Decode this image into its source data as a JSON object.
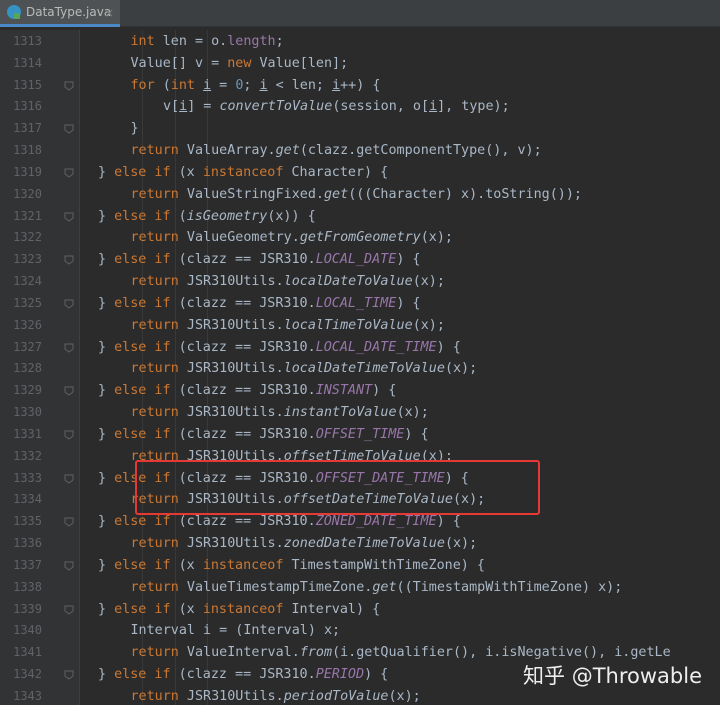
{
  "tab": {
    "label": "DataType.java",
    "close": "×"
  },
  "lines": [
    {
      "n": "1313",
      "fold": false,
      "indent": 3,
      "tokens": [
        [
          "kw",
          "int"
        ],
        [
          "t",
          " len = o."
        ],
        [
          "cst2",
          "length"
        ],
        [
          "t",
          ";"
        ]
      ]
    },
    {
      "n": "1314",
      "fold": false,
      "indent": 3,
      "tokens": [
        [
          "t",
          "Value[] v = "
        ],
        [
          "kw",
          "new"
        ],
        [
          "t",
          " Value[len];"
        ]
      ]
    },
    {
      "n": "1315",
      "fold": true,
      "indent": 3,
      "tokens": [
        [
          "kw",
          "for"
        ],
        [
          "t",
          " ("
        ],
        [
          "kw",
          "int"
        ],
        [
          "t",
          " "
        ],
        [
          "ul",
          "i"
        ],
        [
          "t",
          " = "
        ],
        [
          "num",
          "0"
        ],
        [
          "t",
          "; "
        ],
        [
          "ul",
          "i"
        ],
        [
          "t",
          " < len; "
        ],
        [
          "ul",
          "i"
        ],
        [
          "t",
          "++) {"
        ]
      ]
    },
    {
      "n": "1316",
      "fold": false,
      "indent": 4,
      "tokens": [
        [
          "t",
          "v["
        ],
        [
          "ul",
          "i"
        ],
        [
          "t",
          "] = "
        ],
        [
          "fn",
          "convertToValue"
        ],
        [
          "t",
          "(session, o["
        ],
        [
          "ul",
          "i"
        ],
        [
          "t",
          "], type);"
        ]
      ]
    },
    {
      "n": "1317",
      "fold": true,
      "indent": 3,
      "tokens": [
        [
          "t",
          "}"
        ]
      ]
    },
    {
      "n": "1318",
      "fold": false,
      "indent": 3,
      "tokens": [
        [
          "kw",
          "return"
        ],
        [
          "t",
          " ValueArray."
        ],
        [
          "fn",
          "get"
        ],
        [
          "t",
          "(clazz.getComponentType(), v);"
        ]
      ]
    },
    {
      "n": "1319",
      "fold": true,
      "indent": 2,
      "tokens": [
        [
          "t",
          "} "
        ],
        [
          "kw",
          "else if"
        ],
        [
          "t",
          " (x "
        ],
        [
          "kw",
          "instanceof"
        ],
        [
          "t",
          " Character) {"
        ]
      ]
    },
    {
      "n": "1320",
      "fold": false,
      "indent": 3,
      "tokens": [
        [
          "kw",
          "return"
        ],
        [
          "t",
          " ValueStringFixed."
        ],
        [
          "fn",
          "get"
        ],
        [
          "t",
          "(((Character) x).toString());"
        ]
      ]
    },
    {
      "n": "1321",
      "fold": true,
      "indent": 2,
      "tokens": [
        [
          "t",
          "} "
        ],
        [
          "kw",
          "else if"
        ],
        [
          "t",
          " ("
        ],
        [
          "fn",
          "isGeometry"
        ],
        [
          "t",
          "(x)) {"
        ]
      ]
    },
    {
      "n": "1322",
      "fold": false,
      "indent": 3,
      "tokens": [
        [
          "kw",
          "return"
        ],
        [
          "t",
          " ValueGeometry."
        ],
        [
          "fn",
          "getFromGeometry"
        ],
        [
          "t",
          "(x);"
        ]
      ]
    },
    {
      "n": "1323",
      "fold": true,
      "indent": 2,
      "tokens": [
        [
          "t",
          "} "
        ],
        [
          "kw",
          "else if"
        ],
        [
          "t",
          " (clazz == JSR310."
        ],
        [
          "cst",
          "LOCAL_DATE"
        ],
        [
          "t",
          ") {"
        ]
      ]
    },
    {
      "n": "1324",
      "fold": false,
      "indent": 3,
      "tokens": [
        [
          "kw",
          "return"
        ],
        [
          "t",
          " JSR310Utils."
        ],
        [
          "fn",
          "localDateToValue"
        ],
        [
          "t",
          "(x);"
        ]
      ]
    },
    {
      "n": "1325",
      "fold": true,
      "indent": 2,
      "tokens": [
        [
          "t",
          "} "
        ],
        [
          "kw",
          "else if"
        ],
        [
          "t",
          " (clazz == JSR310."
        ],
        [
          "cst",
          "LOCAL_TIME"
        ],
        [
          "t",
          ") {"
        ]
      ]
    },
    {
      "n": "1326",
      "fold": false,
      "indent": 3,
      "tokens": [
        [
          "kw",
          "return"
        ],
        [
          "t",
          " JSR310Utils."
        ],
        [
          "fn",
          "localTimeToValue"
        ],
        [
          "t",
          "(x);"
        ]
      ]
    },
    {
      "n": "1327",
      "fold": true,
      "indent": 2,
      "tokens": [
        [
          "t",
          "} "
        ],
        [
          "kw",
          "else if"
        ],
        [
          "t",
          " (clazz == JSR310."
        ],
        [
          "cst",
          "LOCAL_DATE_TIME"
        ],
        [
          "t",
          ") {"
        ]
      ]
    },
    {
      "n": "1328",
      "fold": false,
      "indent": 3,
      "tokens": [
        [
          "kw",
          "return"
        ],
        [
          "t",
          " JSR310Utils."
        ],
        [
          "fn",
          "localDateTimeToValue"
        ],
        [
          "t",
          "(x);"
        ]
      ]
    },
    {
      "n": "1329",
      "fold": true,
      "indent": 2,
      "tokens": [
        [
          "t",
          "} "
        ],
        [
          "kw",
          "else if"
        ],
        [
          "t",
          " (clazz == JSR310."
        ],
        [
          "cst",
          "INSTANT"
        ],
        [
          "t",
          ") {"
        ]
      ]
    },
    {
      "n": "1330",
      "fold": false,
      "indent": 3,
      "tokens": [
        [
          "kw",
          "return"
        ],
        [
          "t",
          " JSR310Utils."
        ],
        [
          "fn",
          "instantToValue"
        ],
        [
          "t",
          "(x);"
        ]
      ]
    },
    {
      "n": "1331",
      "fold": true,
      "indent": 2,
      "tokens": [
        [
          "t",
          "} "
        ],
        [
          "kw",
          "else if"
        ],
        [
          "t",
          " (clazz == JSR310."
        ],
        [
          "cst",
          "OFFSET_TIME"
        ],
        [
          "t",
          ") {"
        ]
      ]
    },
    {
      "n": "1332",
      "fold": false,
      "indent": 3,
      "tokens": [
        [
          "kw",
          "return"
        ],
        [
          "t",
          " JSR310Utils."
        ],
        [
          "fn",
          "offsetTimeToValue"
        ],
        [
          "t",
          "(x);"
        ]
      ]
    },
    {
      "n": "1333",
      "fold": true,
      "indent": 2,
      "tokens": [
        [
          "t",
          "} "
        ],
        [
          "kw",
          "else if"
        ],
        [
          "t",
          " (clazz == JSR310."
        ],
        [
          "cst",
          "OFFSET_DATE_TIME"
        ],
        [
          "t",
          ") {"
        ]
      ]
    },
    {
      "n": "1334",
      "fold": false,
      "indent": 3,
      "tokens": [
        [
          "kw",
          "return"
        ],
        [
          "t",
          " JSR310Utils."
        ],
        [
          "fn",
          "offsetDateTimeToValue"
        ],
        [
          "t",
          "(x);"
        ]
      ]
    },
    {
      "n": "1335",
      "fold": true,
      "indent": 2,
      "tokens": [
        [
          "t",
          "} "
        ],
        [
          "kw",
          "else if"
        ],
        [
          "t",
          " (clazz == JSR310."
        ],
        [
          "cst",
          "ZONED_DATE_TIME"
        ],
        [
          "t",
          ") {"
        ]
      ]
    },
    {
      "n": "1336",
      "fold": false,
      "indent": 3,
      "tokens": [
        [
          "kw",
          "return"
        ],
        [
          "t",
          " JSR310Utils."
        ],
        [
          "fn",
          "zonedDateTimeToValue"
        ],
        [
          "t",
          "(x);"
        ]
      ]
    },
    {
      "n": "1337",
      "fold": true,
      "indent": 2,
      "tokens": [
        [
          "t",
          "} "
        ],
        [
          "kw",
          "else if"
        ],
        [
          "t",
          " (x "
        ],
        [
          "kw",
          "instanceof"
        ],
        [
          "t",
          " TimestampWithTimeZone) {"
        ]
      ]
    },
    {
      "n": "1338",
      "fold": false,
      "indent": 3,
      "tokens": [
        [
          "kw",
          "return"
        ],
        [
          "t",
          " ValueTimestampTimeZone."
        ],
        [
          "fn",
          "get"
        ],
        [
          "t",
          "((TimestampWithTimeZone) x);"
        ]
      ]
    },
    {
      "n": "1339",
      "fold": true,
      "indent": 2,
      "tokens": [
        [
          "t",
          "} "
        ],
        [
          "kw",
          "else if"
        ],
        [
          "t",
          " (x "
        ],
        [
          "kw",
          "instanceof"
        ],
        [
          "t",
          " Interval) {"
        ]
      ]
    },
    {
      "n": "1340",
      "fold": false,
      "indent": 3,
      "tokens": [
        [
          "t",
          "Interval i = (Interval) x;"
        ]
      ]
    },
    {
      "n": "1341",
      "fold": false,
      "indent": 3,
      "tokens": [
        [
          "kw",
          "return"
        ],
        [
          "t",
          " ValueInterval."
        ],
        [
          "fn",
          "from"
        ],
        [
          "t",
          "(i.getQualifier(), i.isNegative(), i.getLe"
        ]
      ]
    },
    {
      "n": "1342",
      "fold": true,
      "indent": 2,
      "tokens": [
        [
          "t",
          "} "
        ],
        [
          "kw",
          "else if"
        ],
        [
          "t",
          " (clazz == JSR310."
        ],
        [
          "cst",
          "PERIOD"
        ],
        [
          "t",
          ") {"
        ]
      ]
    },
    {
      "n": "1343",
      "fold": false,
      "indent": 3,
      "tokens": [
        [
          "kw",
          "return"
        ],
        [
          "t",
          " JSR310Utils."
        ],
        [
          "fn",
          "periodToValue"
        ],
        [
          "t",
          "(x);"
        ]
      ]
    }
  ],
  "watermark": "知乎 @Throwable",
  "colors": {
    "background": "#2b2b2b",
    "keyword": "#cc7832",
    "constant": "#9876aa",
    "number": "#6897bb",
    "highlight": "#e53935"
  }
}
